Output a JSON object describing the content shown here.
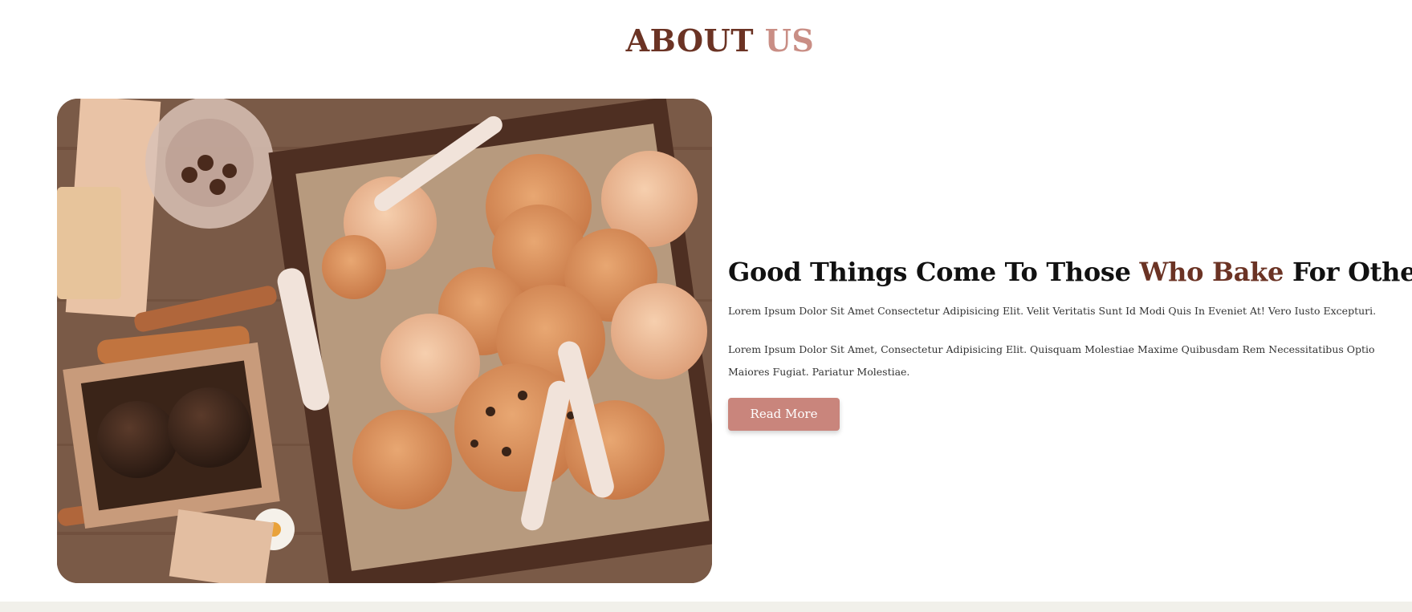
{
  "section": {
    "title_part_1": "ABOUT",
    "title_part_2": "US"
  },
  "about": {
    "image_alt": "cookies in a wooden box",
    "headline_part_1": "Good Things Come To Those",
    "headline_accent": "Who Bake",
    "headline_part_2": "For Others",
    "paragraph_1": "Lorem Ipsum Dolor Sit Amet Consectetur Adipisicing Elit. Velit Veritatis Sunt Id Modi Quis In Eveniet At! Vero Iusto Excepturi.",
    "paragraph_2": "Lorem Ipsum Dolor Sit Amet, Consectetur Adipisicing Elit. Quisquam Molestiae Maxime Quibusdam Rem Necessitatibus Optio Maiores Fugiat. Pariatur Molestiae.",
    "button_label": "Read More"
  },
  "colors": {
    "title_dark": "#6b3324",
    "title_light": "#c98e85",
    "button_bg": "#c9857c",
    "footer_bg": "#f1f0ea"
  }
}
